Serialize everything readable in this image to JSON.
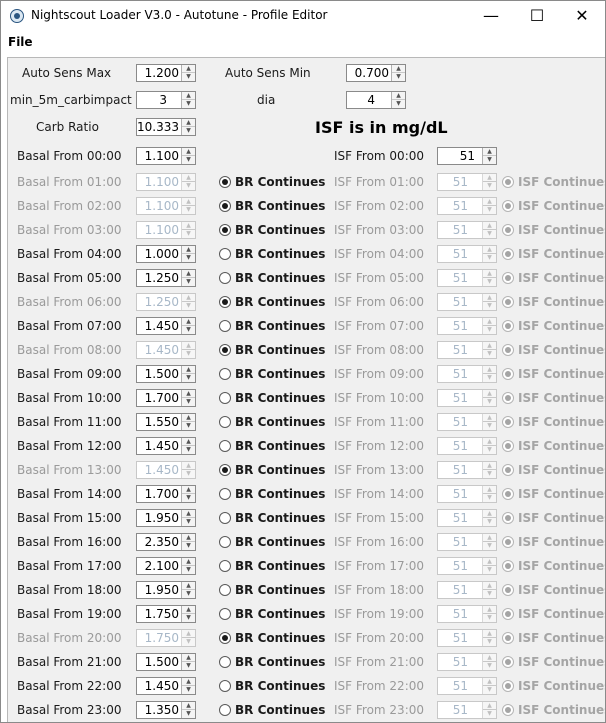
{
  "window": {
    "title": "Nightscout Loader V3.0 - Autotune - Profile Editor",
    "controls": {
      "minimize": "—",
      "maximize": "☐",
      "close": "✕"
    }
  },
  "menu": {
    "file": "File"
  },
  "settings": {
    "auto_sens_max": {
      "label": "Auto Sens Max",
      "value": "1.200"
    },
    "auto_sens_min": {
      "label": "Auto Sens Min",
      "value": "0.700"
    },
    "min_5m_carbimpact": {
      "label": "min_5m_carbimpact",
      "value": "3"
    },
    "dia": {
      "label": "dia",
      "value": "4"
    },
    "carb_ratio": {
      "label": "Carb Ratio",
      "value": "10.333"
    },
    "isf_heading": "ISF is in mg/dL"
  },
  "isf_first": {
    "label": "ISF From 00:00",
    "value": "51"
  },
  "isf_continues_label": "ISF Continues",
  "br_continues_label": "BR Continues",
  "rows": [
    {
      "basal_label": "Basal From 00:00",
      "basal_value": "1.100"
    },
    {
      "basal_label": "Basal From 01:00",
      "basal_value": "1.100",
      "br_continues": true,
      "isf_label": "ISF From 01:00",
      "isf_value": "51"
    },
    {
      "basal_label": "Basal From 02:00",
      "basal_value": "1.100",
      "br_continues": true,
      "isf_label": "ISF From 02:00",
      "isf_value": "51"
    },
    {
      "basal_label": "Basal From 03:00",
      "basal_value": "1.100",
      "br_continues": true,
      "isf_label": "ISF From 03:00",
      "isf_value": "51"
    },
    {
      "basal_label": "Basal From 04:00",
      "basal_value": "1.000",
      "br_continues": false,
      "isf_label": "ISF From 04:00",
      "isf_value": "51"
    },
    {
      "basal_label": "Basal From 05:00",
      "basal_value": "1.250",
      "br_continues": false,
      "isf_label": "ISF From 05:00",
      "isf_value": "51"
    },
    {
      "basal_label": "Basal From 06:00",
      "basal_value": "1.250",
      "br_continues": true,
      "isf_label": "ISF From 06:00",
      "isf_value": "51"
    },
    {
      "basal_label": "Basal From 07:00",
      "basal_value": "1.450",
      "br_continues": false,
      "isf_label": "ISF From 07:00",
      "isf_value": "51"
    },
    {
      "basal_label": "Basal From 08:00",
      "basal_value": "1.450",
      "br_continues": true,
      "isf_label": "ISF From 08:00",
      "isf_value": "51"
    },
    {
      "basal_label": "Basal From 09:00",
      "basal_value": "1.500",
      "br_continues": false,
      "isf_label": "ISF From 09:00",
      "isf_value": "51"
    },
    {
      "basal_label": "Basal From 10:00",
      "basal_value": "1.700",
      "br_continues": false,
      "isf_label": "ISF From 10:00",
      "isf_value": "51"
    },
    {
      "basal_label": "Basal From 11:00",
      "basal_value": "1.550",
      "br_continues": false,
      "isf_label": "ISF From 11:00",
      "isf_value": "51"
    },
    {
      "basal_label": "Basal From 12:00",
      "basal_value": "1.450",
      "br_continues": false,
      "isf_label": "ISF From 12:00",
      "isf_value": "51"
    },
    {
      "basal_label": "Basal From 13:00",
      "basal_value": "1.450",
      "br_continues": true,
      "isf_label": "ISF From 13:00",
      "isf_value": "51"
    },
    {
      "basal_label": "Basal From 14:00",
      "basal_value": "1.700",
      "br_continues": false,
      "isf_label": "ISF From 14:00",
      "isf_value": "51"
    },
    {
      "basal_label": "Basal From 15:00",
      "basal_value": "1.950",
      "br_continues": false,
      "isf_label": "ISF From 15:00",
      "isf_value": "51"
    },
    {
      "basal_label": "Basal From 16:00",
      "basal_value": "2.350",
      "br_continues": false,
      "isf_label": "ISF From 16:00",
      "isf_value": "51"
    },
    {
      "basal_label": "Basal From 17:00",
      "basal_value": "2.100",
      "br_continues": false,
      "isf_label": "ISF From 17:00",
      "isf_value": "51"
    },
    {
      "basal_label": "Basal From 18:00",
      "basal_value": "1.950",
      "br_continues": false,
      "isf_label": "ISF From 18:00",
      "isf_value": "51"
    },
    {
      "basal_label": "Basal From 19:00",
      "basal_value": "1.750",
      "br_continues": false,
      "isf_label": "ISF From 19:00",
      "isf_value": "51"
    },
    {
      "basal_label": "Basal From 20:00",
      "basal_value": "1.750",
      "br_continues": true,
      "isf_label": "ISF From 20:00",
      "isf_value": "51"
    },
    {
      "basal_label": "Basal From 21:00",
      "basal_value": "1.500",
      "br_continues": false,
      "isf_label": "ISF From 21:00",
      "isf_value": "51"
    },
    {
      "basal_label": "Basal From 22:00",
      "basal_value": "1.450",
      "br_continues": false,
      "isf_label": "ISF From 22:00",
      "isf_value": "51"
    },
    {
      "basal_label": "Basal From 23:00",
      "basal_value": "1.350",
      "br_continues": false,
      "isf_label": "ISF From 23:00",
      "isf_value": "51"
    }
  ]
}
